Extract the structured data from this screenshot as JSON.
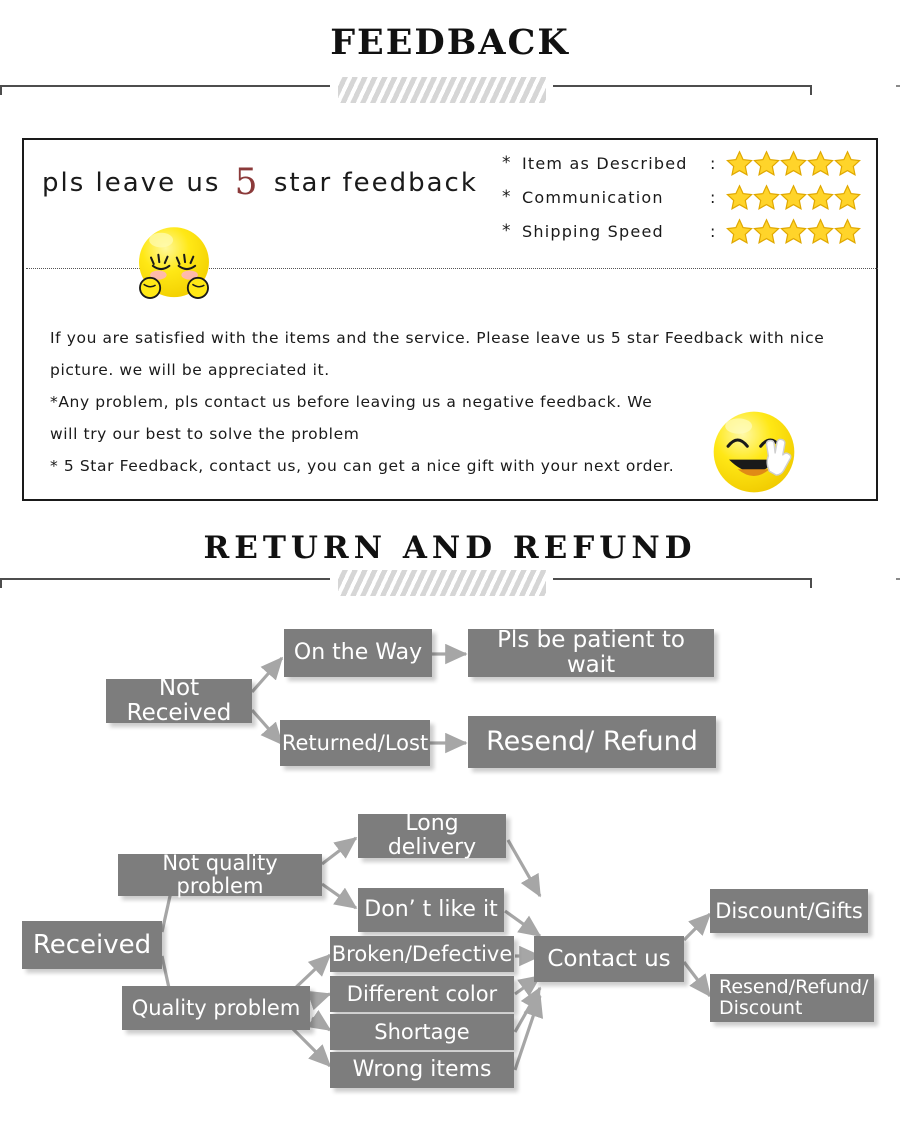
{
  "sections": {
    "feedback_heading": "FEEDBACK",
    "return_heading": "RETURN  AND  REFUND"
  },
  "feedback": {
    "headline_before": "pls leave us",
    "headline_number": "5",
    "headline_after": "star feedback",
    "ratings": [
      {
        "bullet": "*",
        "label": "Item as Described",
        "colon": ":",
        "stars": 5
      },
      {
        "bullet": "*",
        "label": "Communication",
        "colon": ":",
        "stars": 5
      },
      {
        "bullet": "*",
        "label": "Shipping Speed",
        "colon": ":",
        "stars": 5
      }
    ],
    "body_lines": [
      "If you are satisfied with the items and the service. Please leave us 5 star Feedback with nice",
      "picture. we will be appreciated it.",
      "*Any problem, pls contact us before leaving us a negative feedback. We",
      "will try our best to solve  the problem",
      "* 5 Star Feedback, contact us, you can get a nice gift with your next order."
    ],
    "emoji_shy": "shy-face-emoji",
    "emoji_smile": "smiling-peace-sign-emoji"
  },
  "flowchart": {
    "nodes": {
      "not_received": "Not Received",
      "on_the_way": "On the Way",
      "pls_be_patient": "Pls be patient to wait",
      "returned_lost": "Returned/Lost",
      "resend_refund": "Resend/ Refund",
      "received": "Received",
      "not_quality_problem": "Not quality problem",
      "quality_problem": "Quality problem",
      "long_delivery": "Long delivery",
      "dont_like_it": "Don’ t like it",
      "broken_defective": "Broken/Defective",
      "different_color": "Different color",
      "shortage": "Shortage",
      "wrong_items": "Wrong items",
      "contact_us": "Contact us",
      "discount_gifts": "Discount/Gifts",
      "resend_refund_discount": "Resend/Refund/ Discount"
    }
  },
  "colors": {
    "node_fill": "#7d7d7d",
    "node_text": "#ffffff",
    "arrow": "#a6a6a6",
    "star": "#ffd42a",
    "star_outline": "#e0a800",
    "accent_number": "#8b3a3a",
    "rule": "#4d4d4d"
  }
}
